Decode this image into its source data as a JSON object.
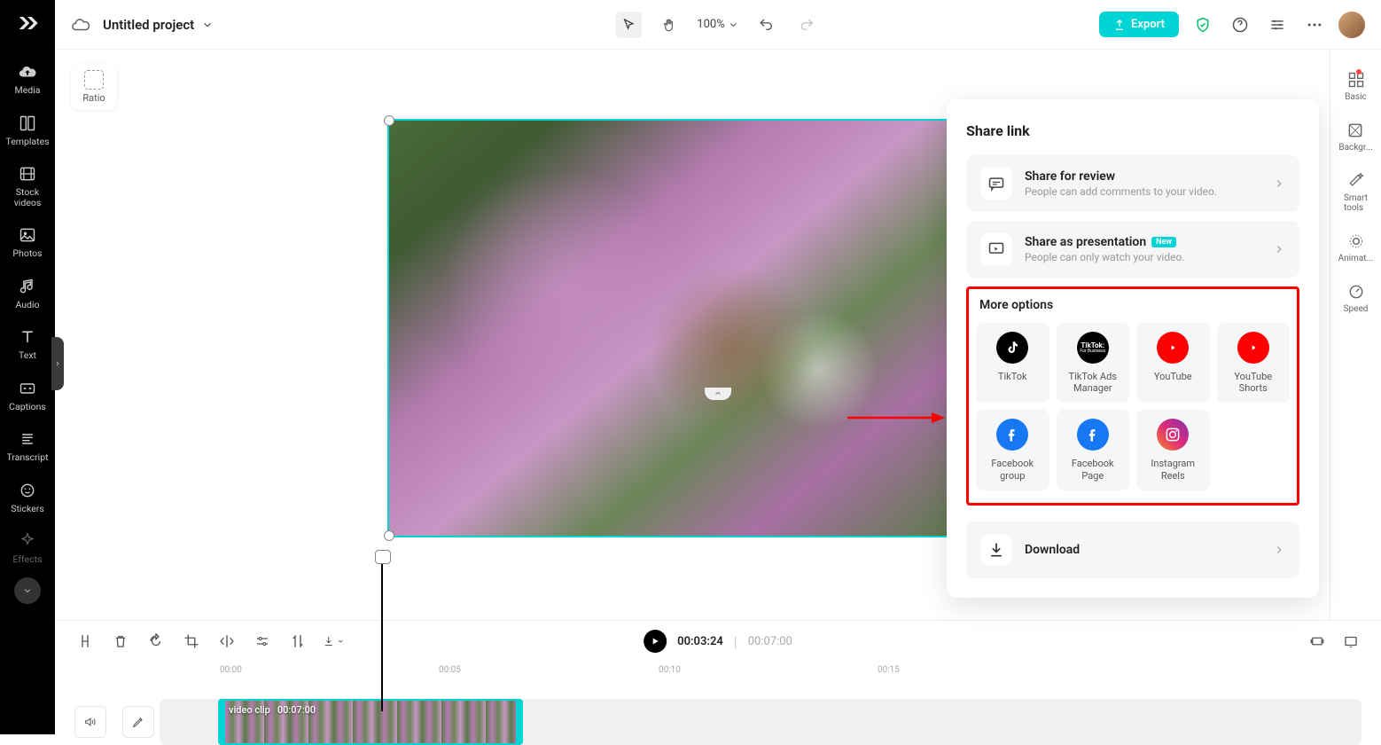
{
  "leftNav": {
    "items": [
      {
        "label": "Media"
      },
      {
        "label": "Templates"
      },
      {
        "label": "Stock\nvideos"
      },
      {
        "label": "Photos"
      },
      {
        "label": "Audio"
      },
      {
        "label": "Text"
      },
      {
        "label": "Captions"
      },
      {
        "label": "Transcript"
      },
      {
        "label": "Stickers"
      },
      {
        "label": "Effects"
      }
    ]
  },
  "topbar": {
    "projectTitle": "Untitled project",
    "zoom": "100%",
    "exportLabel": "Export"
  },
  "canvas": {
    "ratioLabel": "Ratio"
  },
  "rightRail": {
    "items": [
      {
        "label": "Basic"
      },
      {
        "label": "Backgr..."
      },
      {
        "label": "Smart\ntools"
      },
      {
        "label": "Animat..."
      },
      {
        "label": "Speed"
      }
    ]
  },
  "sharePanel": {
    "title": "Share link",
    "review": {
      "title": "Share for review",
      "desc": "People can add comments to your video."
    },
    "presentation": {
      "title": "Share as presentation",
      "badge": "New",
      "desc": "People can only watch your video."
    },
    "moreTitle": "More options",
    "options": [
      {
        "label": "TikTok"
      },
      {
        "label": "TikTok Ads\nManager"
      },
      {
        "label": "YouTube"
      },
      {
        "label": "YouTube\nShorts"
      },
      {
        "label": "Facebook\ngroup"
      },
      {
        "label": "Facebook\nPage"
      },
      {
        "label": "Instagram\nReels"
      }
    ],
    "downloadLabel": "Download"
  },
  "timeline": {
    "current": "00:03:24",
    "total": "00:07:00",
    "marks": [
      "00:00",
      "00:05",
      "00:10",
      "00:15"
    ],
    "clip": {
      "name": "video clip",
      "duration": "00:07:00"
    }
  }
}
